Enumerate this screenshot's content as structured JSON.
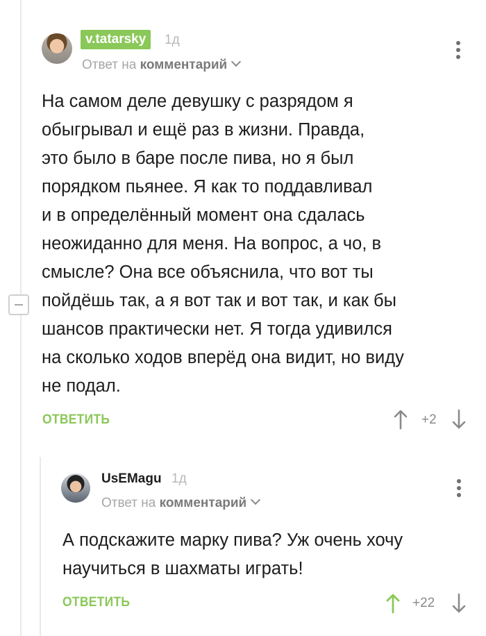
{
  "comment_1": {
    "username": "v.tatarsky",
    "time": "1д",
    "reply_to_prefix": "Ответ на",
    "reply_to_target": "комментарий",
    "text": "На самом деле девушку с разрядом я\nобыгрывал и ещё раз в жизни. Правда,\nэто было в баре после пива, но я был\nпорядком пьянее. Я как то поддавливал\nи в определённый момент она сдалась\nнеожиданно для меня. На вопрос, а чо, в\nсмысле? Она все объяснила, что вот ты\nпойдёшь так, а я вот так и вот так, и как бы\nшансов практически нет. Я тогда удивился\nна сколько ходов вперёд она видит, но виду\nне подал.",
    "reply_label": "ОТВЕТИТЬ",
    "rating": "+2",
    "upvoted": false
  },
  "comment_2": {
    "username": "UsEMagu",
    "time": "1д",
    "reply_to_prefix": "Ответ на",
    "reply_to_target": "комментарий",
    "text": "А подскажите марку пива? Уж очень хочу\nнаучиться в шахматы играть!",
    "reply_label": "ОТВЕТИТЬ",
    "rating": "+22",
    "upvoted": true
  },
  "colors": {
    "accent": "#8ac858",
    "muted": "#a6a6a6",
    "icon": "#6f6f6f"
  },
  "icons": {
    "menu": "kebab-vertical-icon",
    "upvote": "arrow-up-icon",
    "downvote": "arrow-down-icon",
    "collapse": "minus-box-icon",
    "chevron": "chevron-down-icon"
  }
}
